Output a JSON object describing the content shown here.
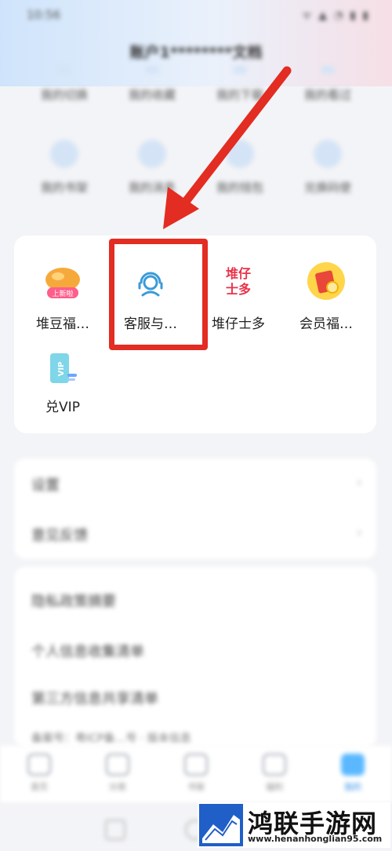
{
  "status_bar": {
    "time": "10:56",
    "icons": "ᯤ ▲ ◔ ▮ ▮"
  },
  "header": {
    "account": "账户1********文档"
  },
  "services_row1": [
    {
      "label": "我的切换",
      "icon": "blurred-icon"
    },
    {
      "label": "我的收藏",
      "icon": "blurred-icon"
    },
    {
      "label": "我的下载",
      "icon": "blurred-icon"
    },
    {
      "label": "我的看过",
      "icon": "blurred-icon"
    }
  ],
  "services_row2": [
    {
      "label": "我的书架",
      "icon": "blurred-icon"
    },
    {
      "label": "我的消息",
      "icon": "blurred-icon"
    },
    {
      "label": "我的钱包",
      "icon": "blurred-icon"
    },
    {
      "label": "兑换码使",
      "icon": "blurred-icon"
    }
  ],
  "tools": [
    {
      "label": "堆豆福…",
      "icon": "dou-icon",
      "badge": "上新啦"
    },
    {
      "label": "客服与…",
      "icon": "customer-service-icon"
    },
    {
      "label": "堆仔士多",
      "icon": "duizai-shop-icon",
      "icon_text_1": "堆仔",
      "icon_text_2": "士多"
    },
    {
      "label": "会员福…",
      "icon": "red-packet-icon"
    },
    {
      "label": "兑VIP",
      "icon": "vip-card-icon",
      "icon_text": "VIP"
    }
  ],
  "list_a": [
    {
      "label": "设置"
    },
    {
      "label": "意见反馈"
    }
  ],
  "list_b": [
    {
      "label": "隐私政策摘要"
    },
    {
      "label": "个人信息收集清单"
    },
    {
      "label": "第三方信息共享清单"
    }
  ],
  "list_b_footnote": "备案号：粤ICP备…号 · 版本信息",
  "tabbar": [
    {
      "label": "首页",
      "icon": "home-icon",
      "active": false
    },
    {
      "label": "分类",
      "icon": "category-icon",
      "active": false
    },
    {
      "label": "书架",
      "icon": "bookshelf-icon",
      "active": false
    },
    {
      "label": "福利",
      "icon": "gift-icon",
      "active": false
    },
    {
      "label": "我的",
      "icon": "profile-icon",
      "active": true
    }
  ],
  "watermark": {
    "title": "鸿联手游网",
    "url": "www.henanhonglian95.com"
  },
  "colors": {
    "highlight": "#e32c22",
    "arrow": "#e32c22",
    "accent": "#2f8fe6"
  }
}
